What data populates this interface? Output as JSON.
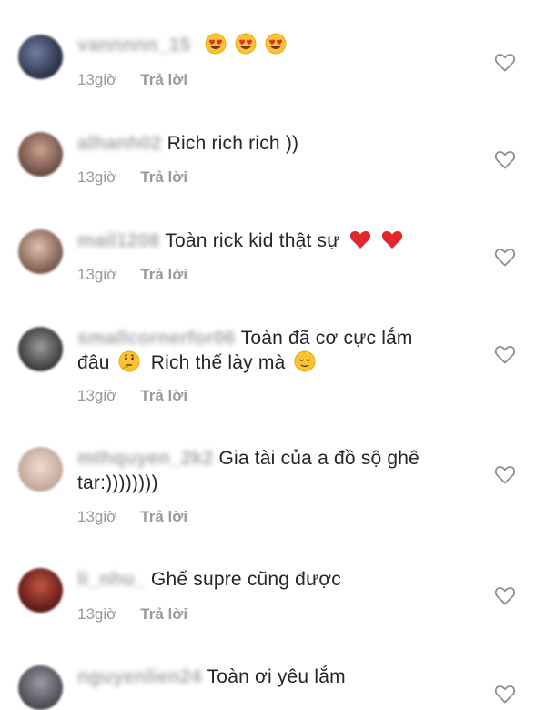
{
  "comments": [
    {
      "username": "vannnnn_15",
      "text": "",
      "emojis": [
        "heart-eyes",
        "heart-eyes",
        "heart-eyes"
      ],
      "time": "13giờ",
      "reply": "Trả lời",
      "avatar_color": "#3a4466"
    },
    {
      "username": "alhanh02",
      "text": "Rich rich rich ))",
      "emojis": [],
      "time": "13giờ",
      "reply": "Trả lời",
      "avatar_color": "#8a6a5a"
    },
    {
      "username": "mail1208",
      "text": "Toàn rick kid thật sự",
      "emojis": [
        "red-heart",
        "red-heart"
      ],
      "time": "13giờ",
      "reply": "Trả lời",
      "avatar_color": "#a07a6a"
    },
    {
      "username": "smallcornerfor06",
      "text": "Toàn đã cơ cực lắm đâu",
      "text2": "Rich thế lày mà",
      "emojis": [
        "thinking"
      ],
      "emojis2": [
        "relieved"
      ],
      "time": "13giờ",
      "reply": "Trả lời",
      "avatar_color": "#555555"
    },
    {
      "username": "mthquyen_2k2",
      "text": "Gia tài của a đồ sộ ghê tar:))))))))",
      "emojis": [],
      "time": "13giờ",
      "reply": "Trả lời",
      "avatar_color": "#d8c2b4"
    },
    {
      "username": "li_nhu_",
      "text": "Ghế supre cũng được",
      "emojis": [],
      "time": "13giờ",
      "reply": "Trả lời",
      "avatar_color": "#8c2a24"
    },
    {
      "username": "nguyenlien24",
      "text": "Toàn ơi yêu lắm",
      "emojis": [],
      "time": "",
      "reply": "",
      "avatar_color": "#6a6a72"
    }
  ],
  "colors": {
    "text": "#262626",
    "meta": "#999999",
    "heart_outline": "#8e8e8e"
  }
}
